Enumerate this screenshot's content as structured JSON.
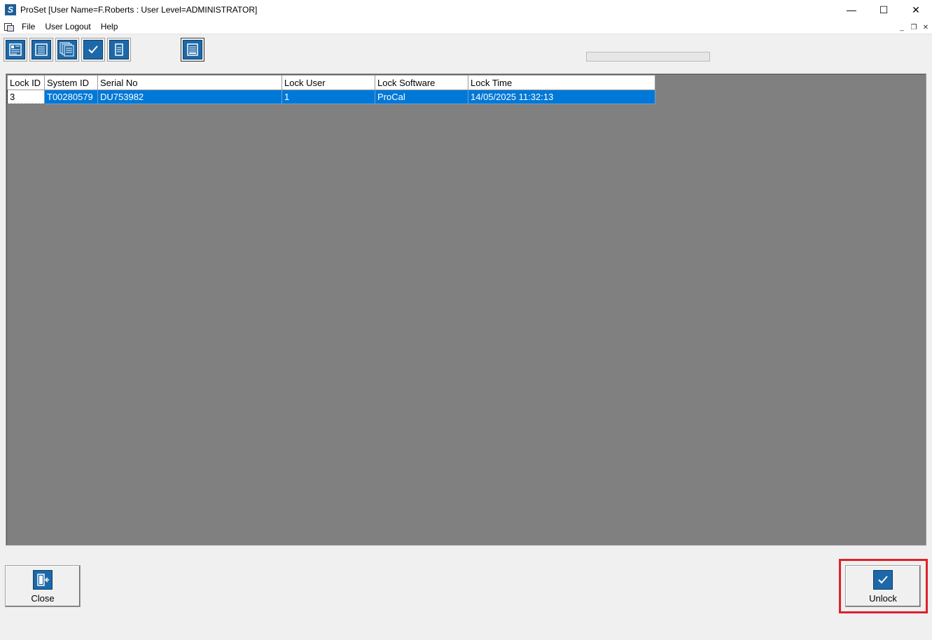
{
  "window": {
    "title": "ProSet [User Name=F.Roberts : User Level=ADMINISTRATOR]",
    "app_icon_letter": "S",
    "minimize": "—",
    "maximize": "☐",
    "close": "✕"
  },
  "menu": {
    "items": [
      "File",
      "User Logout",
      "Help"
    ],
    "mdi_minimize": "_",
    "mdi_restore": "❐",
    "mdi_close": "✕"
  },
  "toolbar": {
    "icons": [
      "record-list-icon",
      "list-icon",
      "stacked-pages-icon",
      "checkmark-icon",
      "single-page-icon",
      "printer-form-icon"
    ]
  },
  "grid": {
    "columns": [
      "Lock ID",
      "System ID",
      "Serial No",
      "Lock User",
      "Lock Software",
      "Lock Time"
    ],
    "rows": [
      [
        "3",
        "T00280579",
        "DU753982",
        "1",
        "ProCal",
        "14/05/2025 11:32:13"
      ]
    ]
  },
  "buttons": {
    "close_label": "Close",
    "unlock_label": "Unlock"
  },
  "colors": {
    "selection": "#0078d7",
    "icon_blue": "#1d68a8",
    "highlight": "#e0202a",
    "grid_bg": "#808080"
  }
}
